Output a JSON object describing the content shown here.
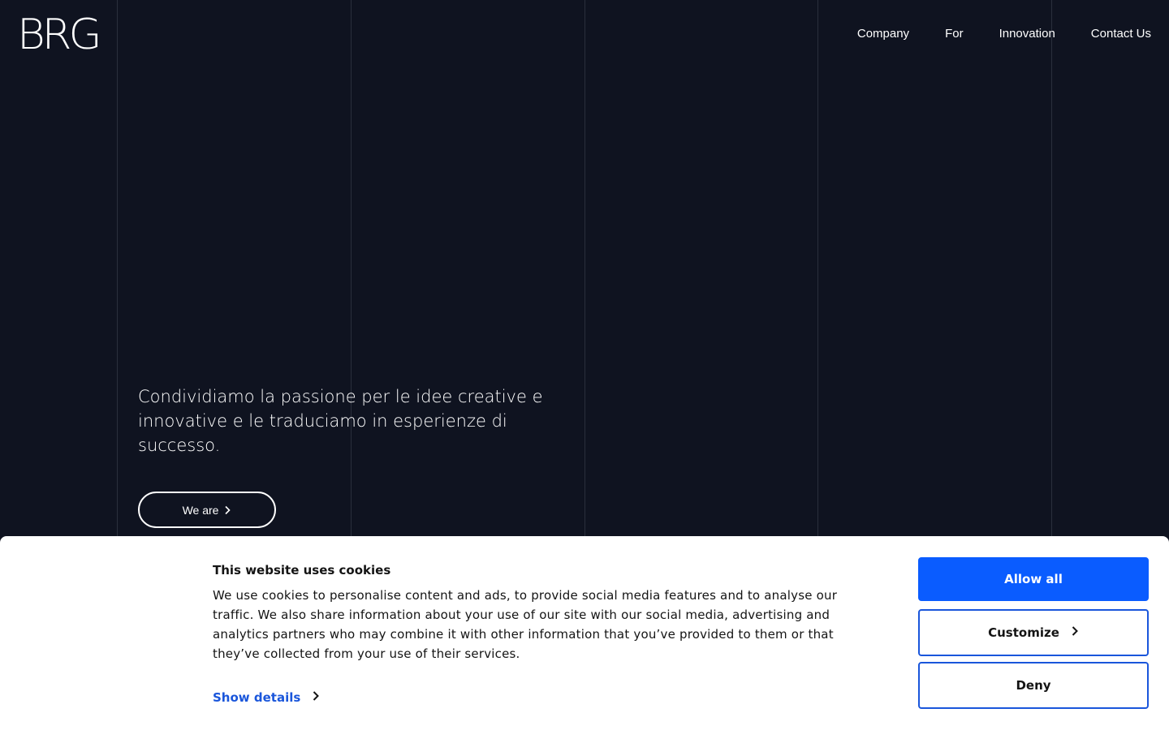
{
  "header": {
    "logo_text": "BRG",
    "nav": [
      {
        "label": "Company"
      },
      {
        "label": "For"
      },
      {
        "label": "Innovation"
      },
      {
        "label": "Contact Us"
      }
    ]
  },
  "hero": {
    "text": "Condividiamo la passione per le idee creative e innovative e le traduciamo in esperienze di successo.",
    "cta_label": "We are"
  },
  "cookie_banner": {
    "title": "This website uses cookies",
    "body": "We use cookies to personalise content and ads, to provide social media features and to analyse our traffic. We also share information about your use of our site with our social media, advertising and analytics partners who may combine it with other information that you’ve provided to them or that they’ve collected from your use of their services.",
    "show_details_label": "Show details",
    "allow_all_label": "Allow all",
    "customize_label": "Customize",
    "deny_label": "Deny"
  },
  "colors": {
    "background": "#0f1320",
    "accent_blue": "#0a5cff",
    "link_blue": "#1a56db"
  },
  "icons": {
    "cta": "chevron-right-icon",
    "show_details": "chevron-right-icon",
    "customize": "chevron-right-icon"
  }
}
